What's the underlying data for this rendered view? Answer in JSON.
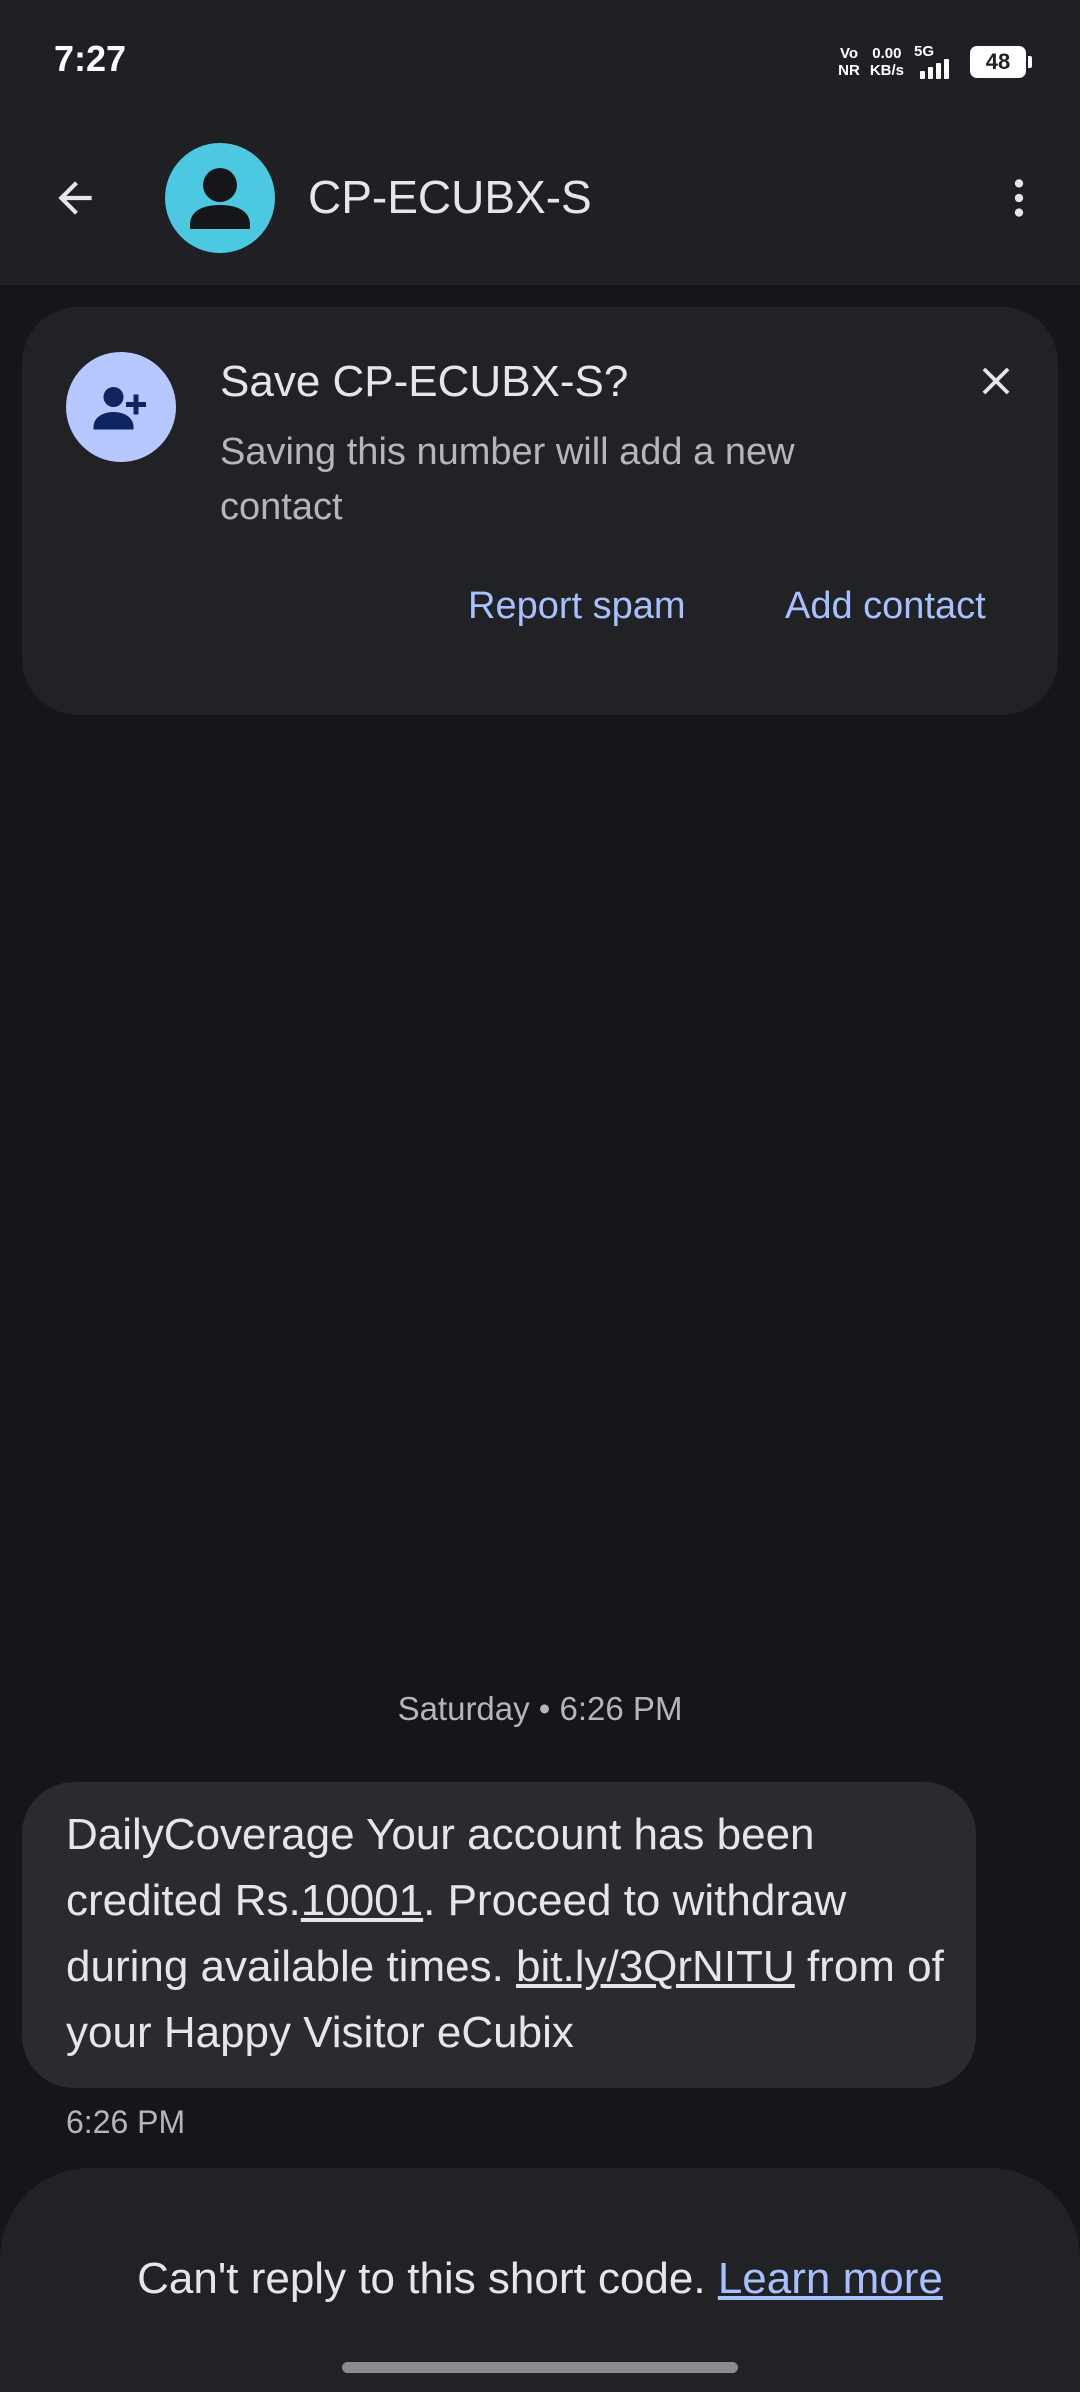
{
  "status_bar": {
    "time": "7:27",
    "network_top": "Vo",
    "network_bottom": "NR",
    "speed_value": "0.00",
    "speed_unit": "KB/s",
    "signal_label": "5G",
    "battery": "48"
  },
  "app_bar": {
    "title": "CP-ECUBX-S",
    "back_icon": "arrow-left-icon",
    "avatar_icon": "person-icon",
    "menu_icon": "more-vert-icon"
  },
  "save_card": {
    "title": "Save CP-ECUBX-S?",
    "text": "Saving this number will add a new contact",
    "report_spam_label": "Report spam",
    "add_contact_label": "Add contact",
    "icon": "person-add-icon",
    "close_icon": "close-icon"
  },
  "conversation": {
    "date_separator": "Saturday • 6:26 PM",
    "message": {
      "part1": "DailyCoverage Your account has been credited Rs.",
      "amount": "10001",
      "part2": ". Proceed to withdraw during available times. ",
      "link": "bit.ly/3QrNITU",
      "part3": " from of your Happy Visitor eCubix",
      "time": "6:26 PM"
    }
  },
  "footer": {
    "text": "Can't reply to this short code. ",
    "link": "Learn more"
  },
  "colors": {
    "background": "#15161a",
    "surface": "#212226",
    "bubble": "#2a2b30",
    "accent": "#a9c0ff",
    "avatar": "#4cc9e0"
  }
}
